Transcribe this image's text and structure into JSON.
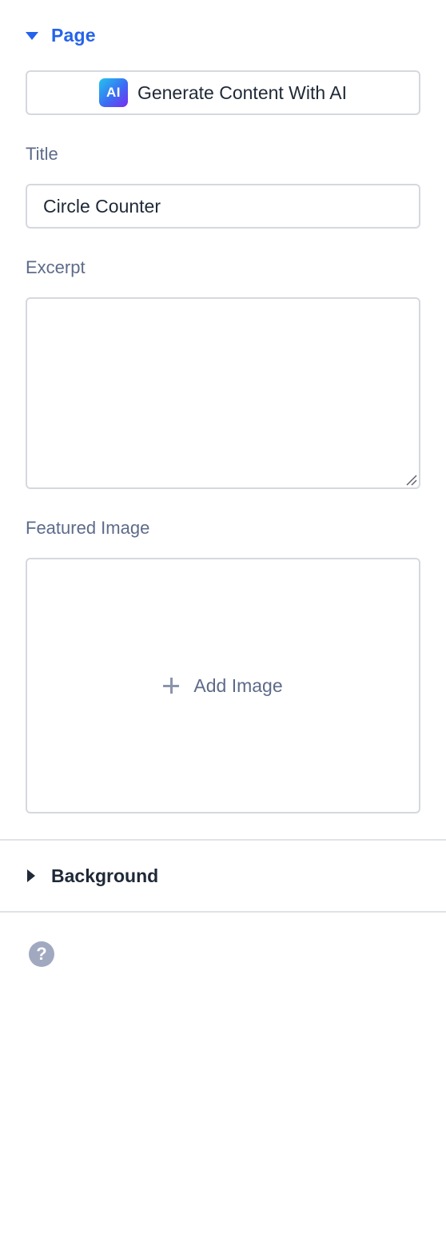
{
  "page_section": {
    "label": "Page",
    "expanded": true,
    "ai_button": {
      "badge": "AI",
      "label": "Generate Content With AI"
    },
    "title_field": {
      "label": "Title",
      "value": "Circle Counter"
    },
    "excerpt_field": {
      "label": "Excerpt",
      "value": ""
    },
    "featured_image": {
      "label": "Featured Image",
      "add_label": "Add Image",
      "icon": "plus-icon"
    }
  },
  "background_section": {
    "label": "Background",
    "expanded": false
  },
  "help": {
    "glyph": "?",
    "icon": "help-icon"
  },
  "colors": {
    "accent": "#2563eb",
    "label": "#5d6b8a",
    "border": "#d5d8de",
    "help_icon": "#a1a9c1"
  }
}
